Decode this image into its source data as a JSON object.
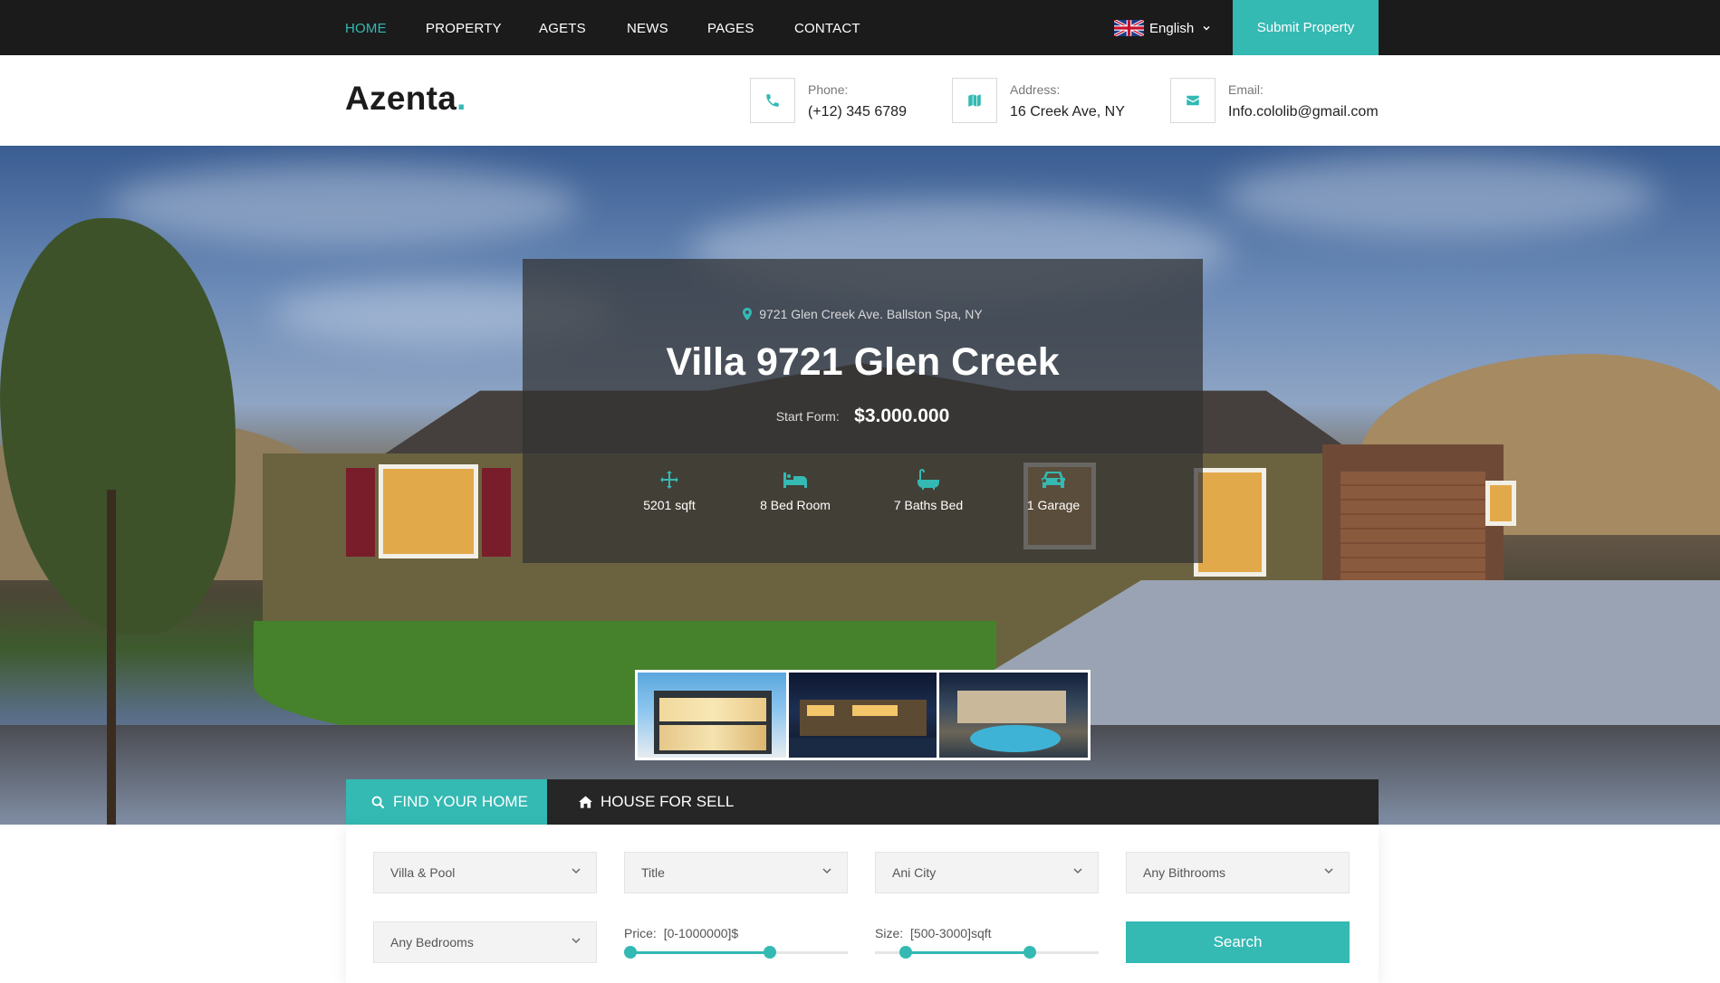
{
  "nav": {
    "items": [
      {
        "label": "HOME"
      },
      {
        "label": "PROPERTY"
      },
      {
        "label": "AGETS"
      },
      {
        "label": "NEWS"
      },
      {
        "label": "PAGES"
      },
      {
        "label": "CONTACT"
      }
    ],
    "language": "English",
    "submit_label": "Submit Property"
  },
  "header": {
    "logo_text": "Azenta",
    "logo_dot": ".",
    "phone_label": "Phone:",
    "phone_value": "(+12) 345 6789",
    "address_label": "Address:",
    "address_value": "16 Creek Ave, NY",
    "email_label": "Email:",
    "email_value": "Info.cololib@gmail.com"
  },
  "hero": {
    "address": "9721 Glen Creek Ave. Ballston Spa, NY",
    "title": "Villa 9721 Glen Creek",
    "price_label": "Start Form:",
    "price_value": "$3.000.000",
    "features": [
      {
        "icon": "area-arrows-icon",
        "label": "5201 sqft"
      },
      {
        "icon": "bed-icon",
        "label": "8 Bed Room"
      },
      {
        "icon": "bath-icon",
        "label": "7 Baths Bed"
      },
      {
        "icon": "car-icon",
        "label": "1 Garage"
      }
    ]
  },
  "search": {
    "tabs": [
      {
        "label": "FIND YOUR HOME",
        "icon": "search-icon"
      },
      {
        "label": "HOUSE FOR SELL",
        "icon": "home-icon"
      }
    ],
    "selects": {
      "type": "Villa & Pool",
      "title": "Title",
      "city": "Ani City",
      "bathrooms": "Any Bithrooms",
      "bedrooms": "Any Bedrooms"
    },
    "price": {
      "label": "Price:",
      "range_text": "[0-1000000]$",
      "min": 0,
      "max": 1000000
    },
    "size": {
      "label": "Size:",
      "range_text": "[500-3000]sqft",
      "min": 500,
      "max": 3000
    },
    "button_label": "Search"
  },
  "colors": {
    "accent": "#34b9b3",
    "topbar": "#1b1b1b",
    "tabbar": "#262626"
  }
}
